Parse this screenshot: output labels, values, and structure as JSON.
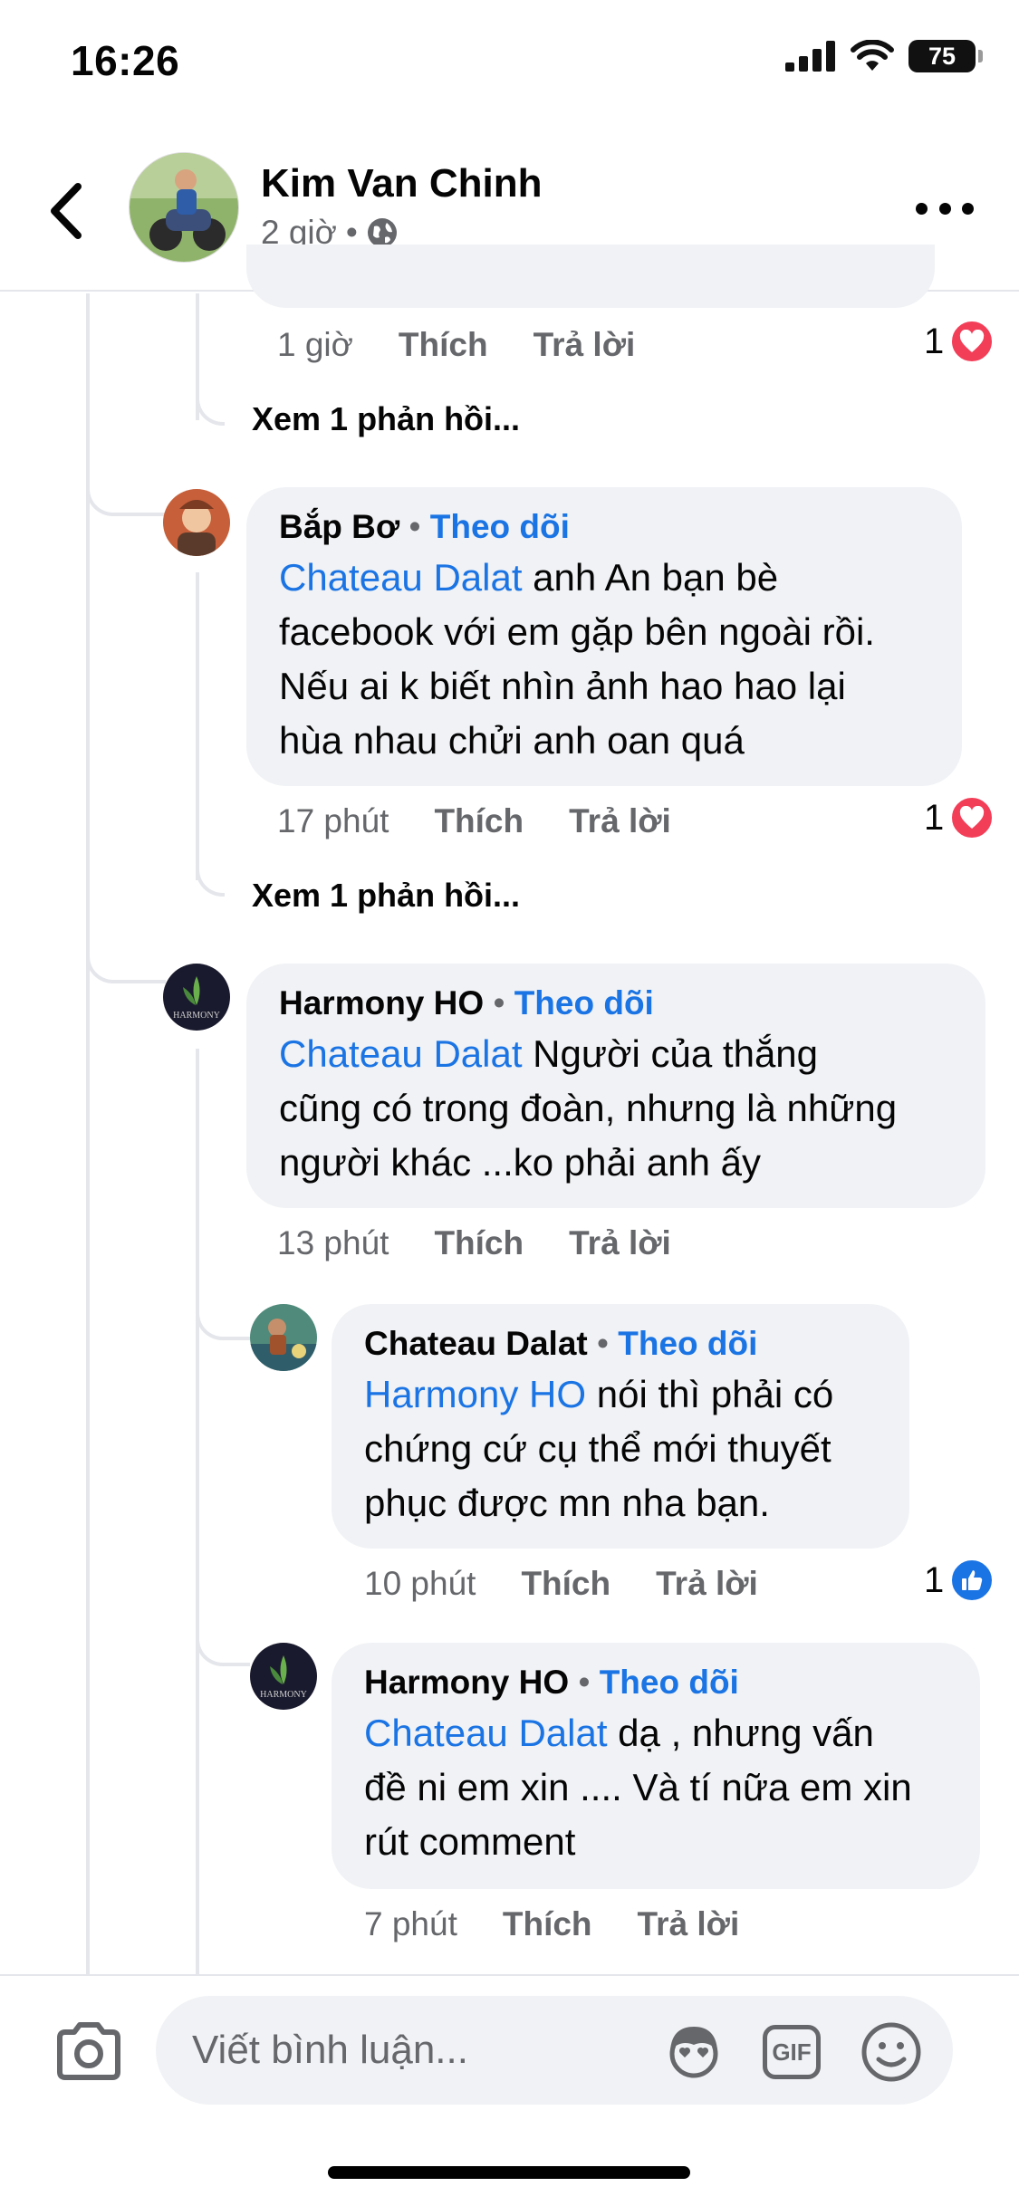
{
  "status_bar": {
    "time": "16:26",
    "battery": "75"
  },
  "header": {
    "name": "Kim Van Chinh",
    "time": "2 giờ",
    "separator": "•",
    "privacy_icon": "globe-icon"
  },
  "thread_top": {
    "time": "1 giờ",
    "like_label": "Thích",
    "reply_label": "Trả lời",
    "reaction_count": "1",
    "reaction_icon": "heart-icon",
    "see_more": "Xem 1 phản hồi..."
  },
  "comments": [
    {
      "author": "Bắp Bơ",
      "dot": "•",
      "follow_label": "Theo dõi",
      "mention": "Chateau Dalat",
      "line1_rest": " anh An bạn bè",
      "line2": "facebook với em gặp bên ngoài rồi.",
      "line3": "Nếu ai k biết nhìn ảnh hao hao lại",
      "line4": "hùa nhau chửi anh oan quá",
      "time": "17 phút",
      "like_label": "Thích",
      "reply_label": "Trả lời",
      "reaction_count": "1",
      "reaction_icon": "heart-icon",
      "see_more": "Xem 1 phản hồi..."
    },
    {
      "author": "Harmony HO",
      "dot": "•",
      "follow_label": "Theo dõi",
      "mention": "Chateau Dalat",
      "line1_rest": " Người của thắng",
      "line2": "cũng có trong đoàn, nhưng là những",
      "line3": "người khác ...ko phải anh ấy",
      "time": "13 phút",
      "like_label": "Thích",
      "reply_label": "Trả lời"
    },
    {
      "author": "Chateau Dalat",
      "dot": "•",
      "follow_label": "Theo dõi",
      "mention": "Harmony HO",
      "line1_rest": " nói thì phải có",
      "line2": "chứng cứ cụ thể mới thuyết",
      "line3": "phục được mn nha bạn.",
      "time": "10 phút",
      "like_label": "Thích",
      "reply_label": "Trả lời",
      "reaction_count": "1",
      "reaction_icon": "like-icon"
    },
    {
      "author": "Harmony HO",
      "dot": "•",
      "follow_label": "Theo dõi",
      "mention": "Chateau Dalat",
      "line1_rest": " dạ , nhưng vấn",
      "line2": "đề ni em xin .... Và tí nữa em xin",
      "line3": "rút comment",
      "time": "7 phút",
      "like_label": "Thích",
      "reply_label": "Trả lời"
    }
  ],
  "composer": {
    "placeholder": "Viết bình luận...",
    "gif_label": "GIF"
  },
  "colors": {
    "accent": "#1b74e4",
    "bubble": "#f0f2f5",
    "heart": "#f33e58",
    "line": "#e4e6eb"
  }
}
